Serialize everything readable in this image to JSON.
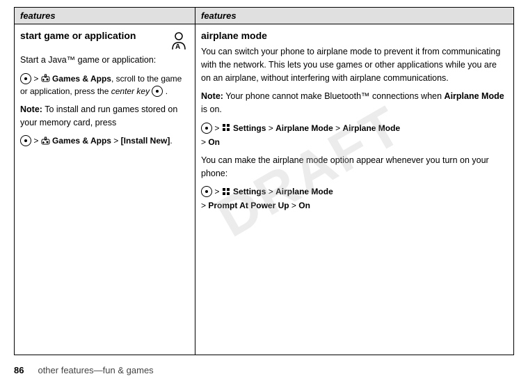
{
  "page": {
    "left_column": {
      "header": "features",
      "section_title": "start game or application",
      "intro_text": "Start a Java™ game or application:",
      "menu_path_1a": "> ",
      "menu_path_1b": " Games & Apps",
      "menu_path_1c": ", scroll to the game or application, press the ",
      "menu_path_1d": "center key",
      "menu_path_1e": " .",
      "note_label": "Note:",
      "note_text": " To install and run games stored on your memory card, press",
      "menu_path_2a": "> ",
      "menu_path_2b": " Games & Apps",
      "menu_path_2c": " > ",
      "menu_path_2d": "[Install New]",
      "menu_path_2e": "."
    },
    "right_column": {
      "header": "features",
      "section_title": "airplane mode",
      "body_text_1": "You can switch your phone to airplane mode to prevent it from communicating with the network. This lets you use games or other applications while you are on an airplane, without interfering with airplane communications.",
      "note_label": "Note:",
      "note_text": " Your phone cannot make Bluetooth™ connections when ",
      "note_bold": "Airplane Mode",
      "note_text_2": " is on.",
      "menu_path_1": "> ",
      "menu_path_1b": " Settings > Airplane Mode > Airplane Mode",
      "menu_path_1c": "> On",
      "body_text_2": "You can make the airplane mode option appear whenever you turn on your phone:",
      "menu_path_2": "> ",
      "menu_path_2b": " Settings > Airplane Mode",
      "menu_path_2c": "> Prompt At Power Up > On"
    },
    "footer": {
      "page_number": "86",
      "text": "other features—fun & games"
    },
    "watermark": "DRAFT"
  }
}
